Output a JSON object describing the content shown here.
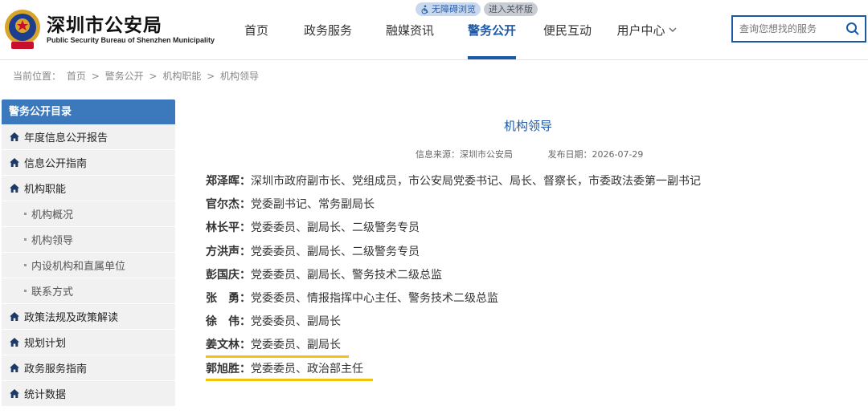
{
  "header": {
    "site_title": "深圳市公安局",
    "site_subtitle": "Public Security Bureau of Shenzhen Municipality",
    "accessibility_label": "无障碍浏览",
    "elder_label": "进入关怀版",
    "search_placeholder": "查询您想找的服务"
  },
  "nav": [
    {
      "label": "首页"
    },
    {
      "label": "政务服务"
    },
    {
      "label": "融媒资讯"
    },
    {
      "label": "警务公开"
    },
    {
      "label": "便民互动"
    },
    {
      "label": "用户中心"
    }
  ],
  "breadcrumb": {
    "prefix": "当前位置：",
    "items": [
      "首页",
      ">",
      "警务公开",
      ">",
      "机构职能",
      ">",
      "机构领导"
    ]
  },
  "sidebar": {
    "title": "警务公开目录",
    "items": [
      {
        "label": "年度信息公开报告"
      },
      {
        "label": "信息公开指南"
      },
      {
        "label": "机构职能"
      }
    ],
    "subitems": [
      {
        "label": "机构概况"
      },
      {
        "label": "机构领导"
      },
      {
        "label": "内设机构和直属单位"
      },
      {
        "label": "联系方式"
      }
    ],
    "items_after": [
      {
        "label": "政策法规及政策解读"
      },
      {
        "label": "规划计划"
      },
      {
        "label": "政务服务指南"
      },
      {
        "label": "统计数据"
      }
    ]
  },
  "article": {
    "title": "机构领导",
    "source": "信息来源：深圳市公安局",
    "date": "发布日期：2026-07-29",
    "leaders": [
      {
        "name": "郑泽晖：",
        "role": "深圳市政府副市长、党组成员，市公安局党委书记、局长、督察长，市委政法委第一副书记"
      },
      {
        "name": "官尔杰：",
        "role": "党委副书记、常务副局长"
      },
      {
        "name": "林长平：",
        "role": "党委委员、副局长、二级警务专员"
      },
      {
        "name": "方洪声：",
        "role": "党委委员、副局长、二级警务专员"
      },
      {
        "name": "彭国庆：",
        "role": "党委委员、副局长、警务技术二级总监"
      },
      {
        "name": "张　勇：",
        "role": "党委委员、情报指挥中心主任、警务技术二级总监"
      },
      {
        "name": "徐　伟：",
        "role": "党委委员、副局长"
      },
      {
        "name": "姜文林：",
        "role": "党委委员、副局长"
      },
      {
        "name": "郭旭胜：",
        "role": "党委委员、政治部主任"
      }
    ]
  },
  "colors": {
    "brand_blue": "#1b59a6",
    "sidebar_head": "#3b78bc",
    "highlight_underline": "#f4c20d"
  },
  "icons": [
    "police-emblem-icon",
    "wheelchair-icon",
    "search-icon",
    "home-icon",
    "chevron-down-icon"
  ]
}
